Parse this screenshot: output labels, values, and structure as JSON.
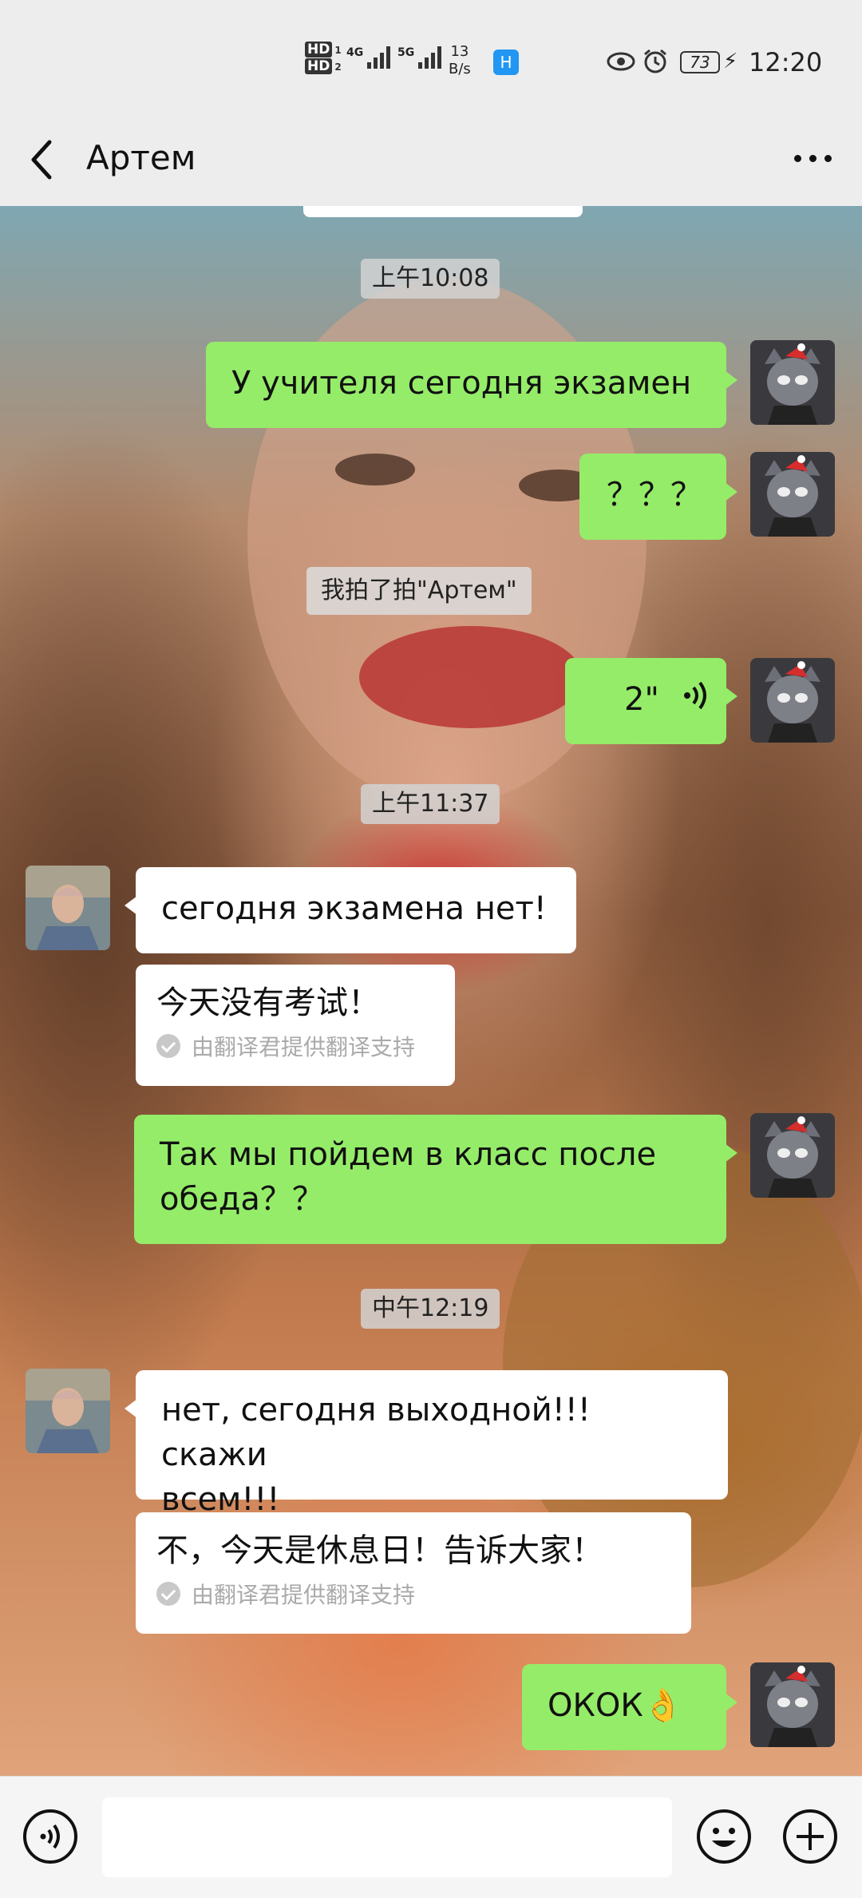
{
  "status_bar": {
    "hd_top": "HD",
    "hd_top_sub": "1",
    "hd_bottom": "HD",
    "hd_bottom_sub": "2",
    "net_1": "4G",
    "net_2": "5G",
    "speed_value": "13",
    "speed_unit": "B/s",
    "app_badge": "H",
    "battery": "73",
    "time": "12:20"
  },
  "header": {
    "title": "Артем"
  },
  "messages": [
    {
      "type": "timestamp",
      "text": "上午10:08"
    },
    {
      "type": "out",
      "text": "У учителя сегодня экзамен"
    },
    {
      "type": "out",
      "text": "？？？"
    },
    {
      "type": "system",
      "text": "我拍了拍\"Артем\""
    },
    {
      "type": "out_voice",
      "text": "2\""
    },
    {
      "type": "timestamp",
      "text": "上午11:37"
    },
    {
      "type": "in",
      "text": "сегодня экзамена нет!"
    },
    {
      "type": "translation",
      "text": "今天没有考试！",
      "note": "由翻译君提供翻译支持"
    },
    {
      "type": "out",
      "text_line1": "Так мы пойдем в класс после",
      "text_line2": "обеда？？"
    },
    {
      "type": "timestamp",
      "text": "中午12:19"
    },
    {
      "type": "in",
      "text_line1": "нет, сегодня выходной!!! скажи",
      "text_line2": "всем!!!"
    },
    {
      "type": "translation",
      "text": "不，今天是休息日！告诉大家！",
      "note": "由翻译君提供翻译支持"
    },
    {
      "type": "out",
      "text": "ОКОК",
      "emoji": "👌"
    }
  ],
  "colors": {
    "outgoing_bubble": "#95ec69",
    "incoming_bubble": "#ffffff",
    "background": "#ededed"
  },
  "icons": {
    "back": "chevron-left-icon",
    "more": "more-dots-icon",
    "voice_input": "voice-input-icon",
    "emoji": "emoji-icon",
    "plus": "plus-icon"
  }
}
